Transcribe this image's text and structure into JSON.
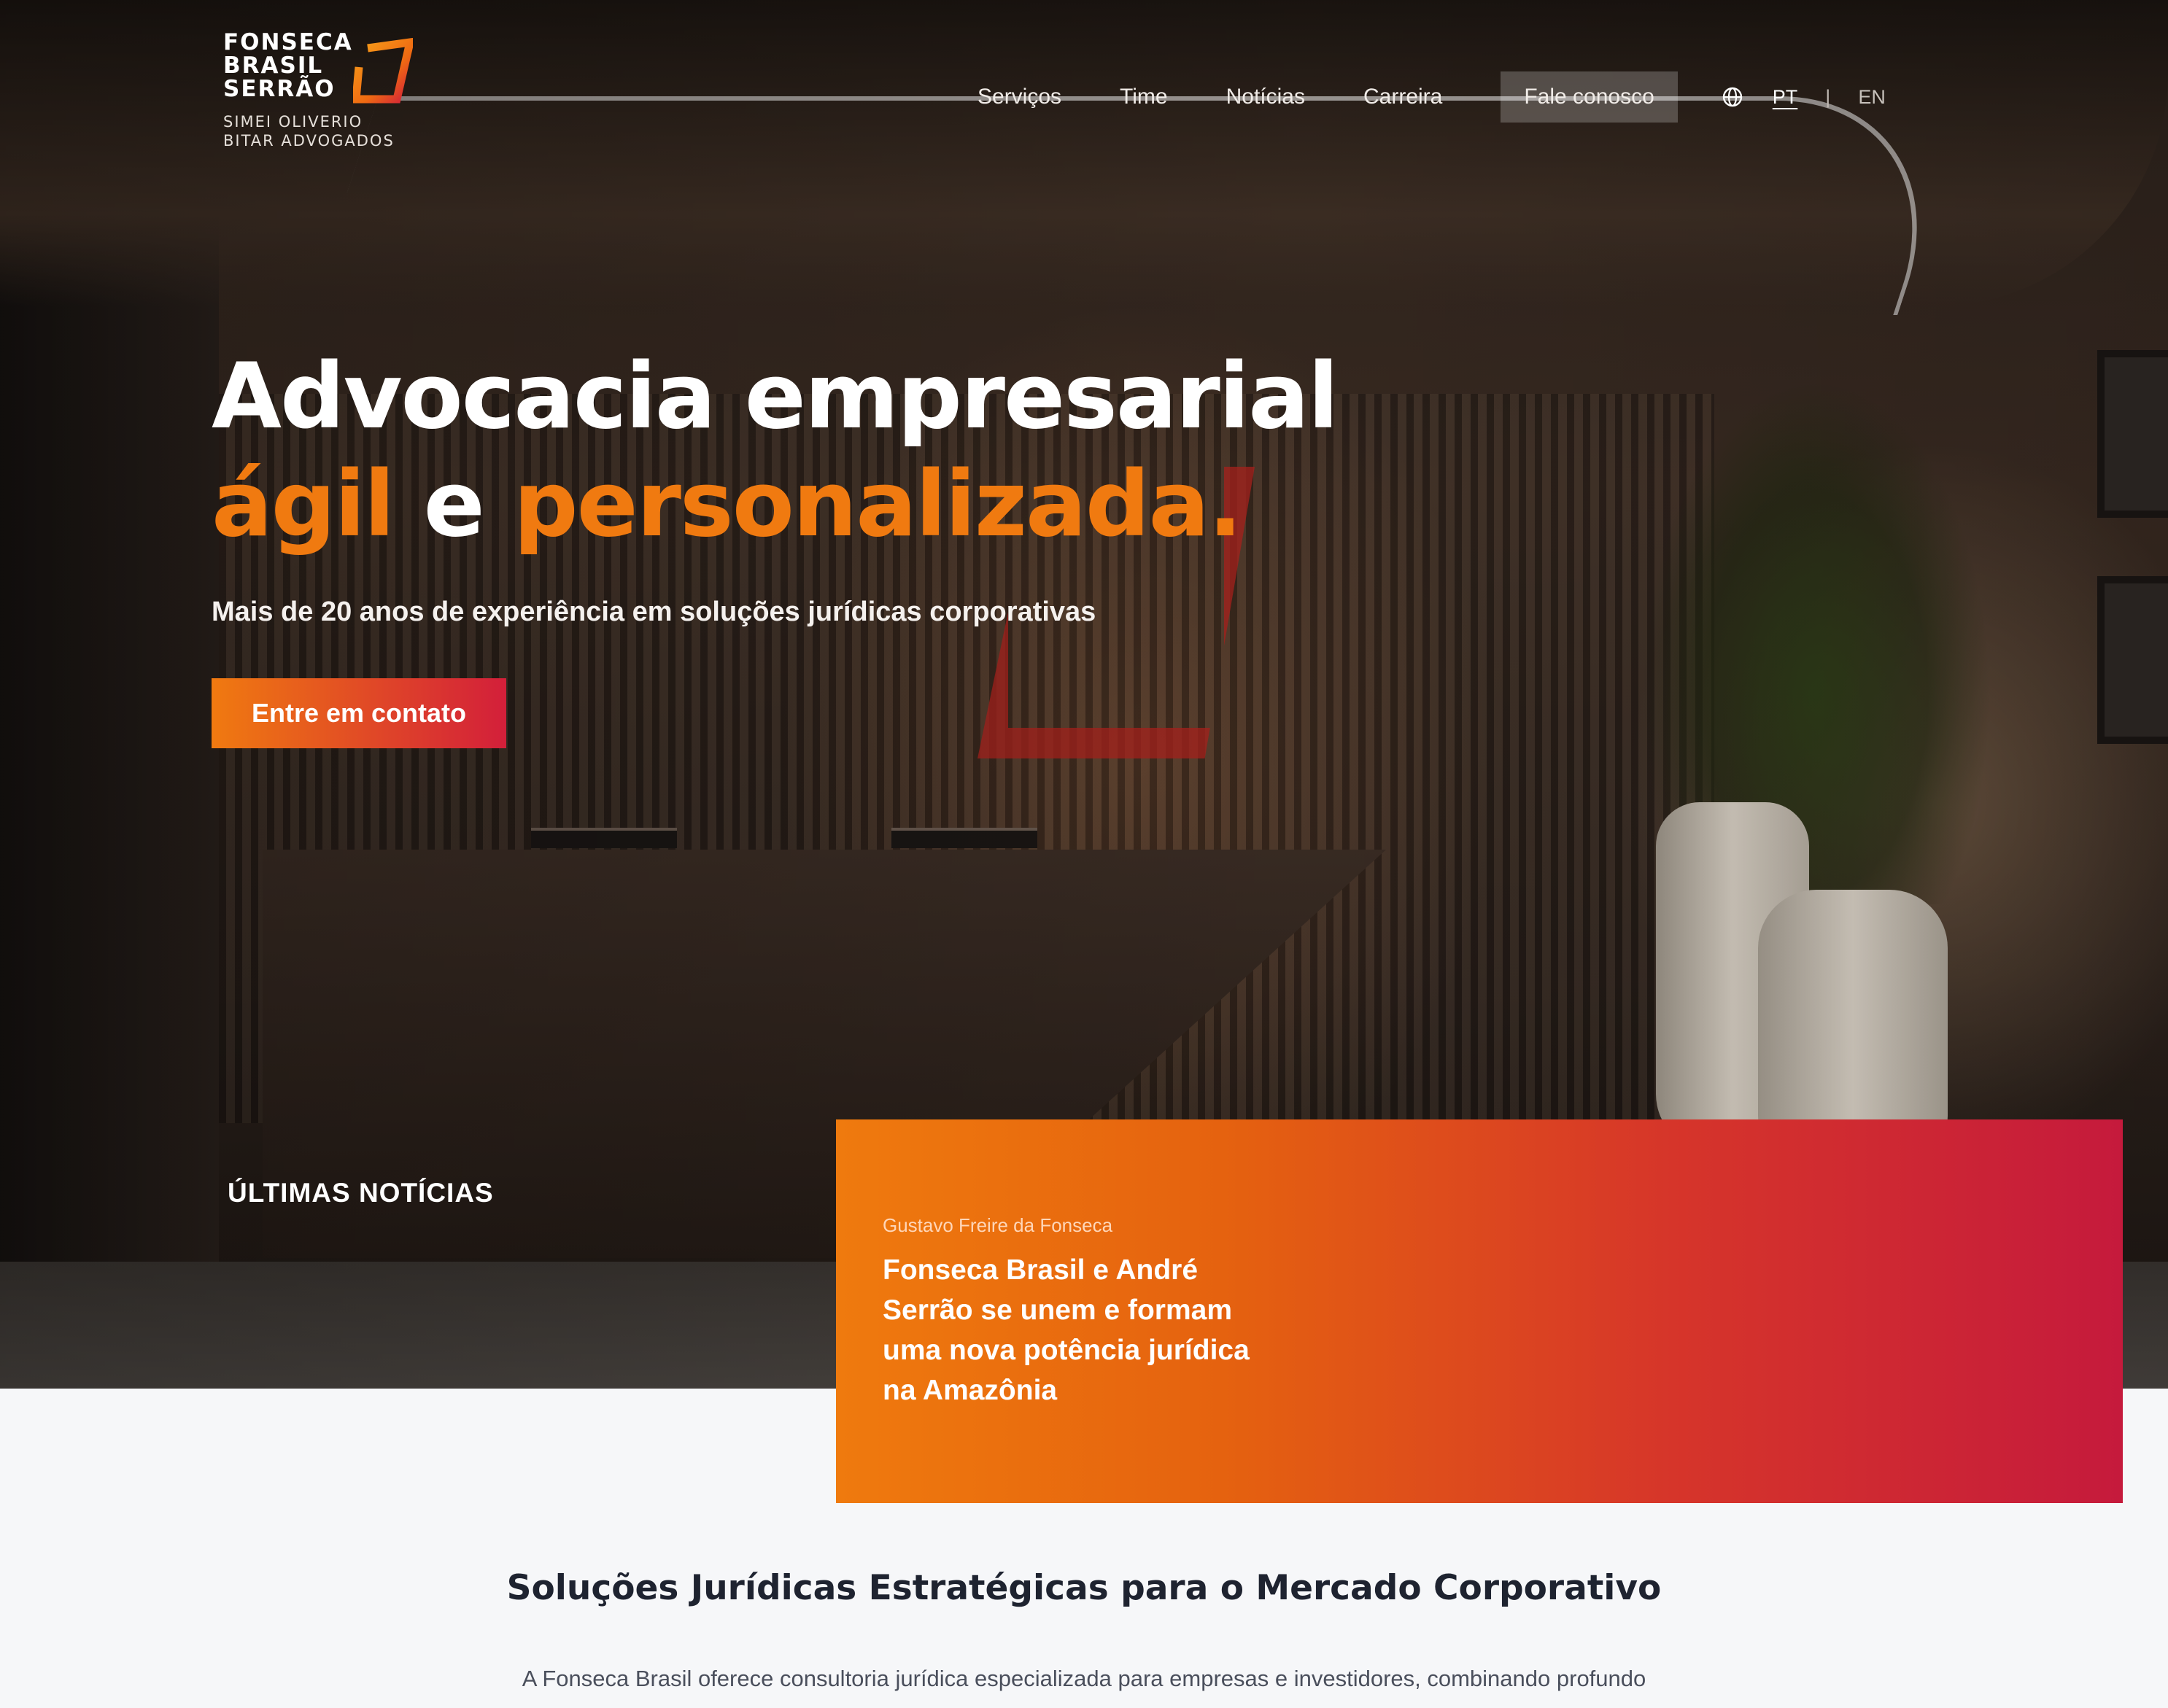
{
  "brand": {
    "logo_name": "FONSECA\nBRASIL\nSERRÃO",
    "logo_subtitle": "SIMEI OLIVERIO\nBITAR ADVOGADOS",
    "accent_orange": "#f07a10",
    "accent_red": "#d31f3a"
  },
  "nav": {
    "items": [
      {
        "label": "Serviços"
      },
      {
        "label": "Time"
      },
      {
        "label": "Notícias"
      },
      {
        "label": "Carreira"
      }
    ],
    "cta_label": "Fale conosco",
    "globe_icon": "globe-icon",
    "lang_active": "PT",
    "lang_separator": "|",
    "lang_other": "EN"
  },
  "hero": {
    "headline_line1": "Advocacia empresarial",
    "headline_word1": "ágil",
    "headline_connector": "e",
    "headline_word2": "personalizada.",
    "subheadline": "Mais de 20 anos de experiência em soluções jurídicas corporativas",
    "cta_label": "Entre em contato"
  },
  "news": {
    "section_title": "ÚLTIMAS NOTÍCIAS",
    "card": {
      "author": "Gustavo Freire da Fonseca",
      "headline": "Fonseca Brasil e André Serrão se unem e formam uma nova potência jurídica na Amazônia"
    }
  },
  "solutions": {
    "title": "Soluções Jurídicas Estratégicas para o Mercado Corporativo",
    "body": "A Fonseca Brasil oferece consultoria jurídica especializada para empresas e investidores, combinando profundo"
  }
}
